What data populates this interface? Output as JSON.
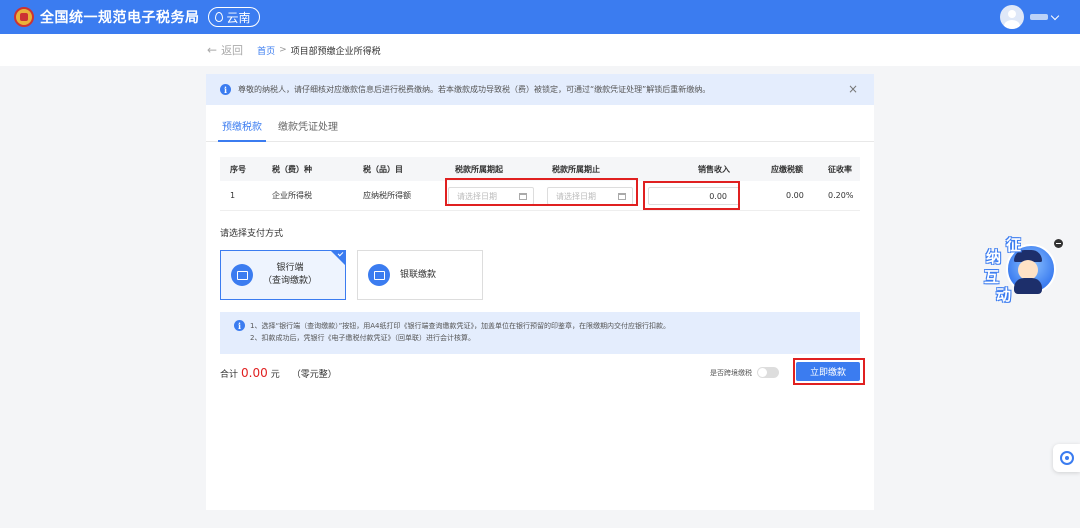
{
  "header": {
    "app_title": "全国统一规范电子税务局",
    "region": "云南",
    "emblem_icon": "tax-emblem-icon",
    "location_icon": "location-pin-icon",
    "avatar_icon": "user-avatar-icon",
    "dropdown_icon": "chevron-down-icon"
  },
  "breadcrumb": {
    "back_label": "返回",
    "home": "首页",
    "separator": ">",
    "current": "项目部预缴企业所得税"
  },
  "notice": {
    "text": "尊敬的纳税人，请仔细核对应缴款信息后进行税费缴纳。若本缴款成功导致税（费）被锁定，可通过“缴款凭证处理”解锁后重新缴纳。",
    "close": "×"
  },
  "tabs": [
    {
      "label": "预缴税款",
      "active": true
    },
    {
      "label": "缴款凭证处理",
      "active": false
    }
  ],
  "table": {
    "headers": [
      "序号",
      "税（费）种",
      "税（品）目",
      "税款所属期起",
      "税款所属期止",
      "销售收入",
      "应缴税额",
      "征收率"
    ],
    "rows": [
      {
        "index": "1",
        "tax_type": "企业所得税",
        "tax_item": "应纳税所得额",
        "period_start_placeholder": "请选择日期",
        "period_end_placeholder": "请选择日期",
        "sales_income": "0.00",
        "tax_due": "0.00",
        "rate": "0.20%"
      }
    ]
  },
  "payment": {
    "label": "请选择支付方式",
    "options": [
      {
        "line1": "银行端",
        "line2": "（查询缴款）",
        "selected": true
      },
      {
        "line1": "银联缴款",
        "line2": "",
        "selected": false
      }
    ]
  },
  "tip": {
    "line1": "1、选择“银行端（查询缴款）”按钮，用A4纸打印《银行端查询缴款凭证》，加盖单位在银行预留的印鉴章，在限缴期内交付应银行扣款。",
    "line2": "2、扣款成功后，凭银行《电子缴税付款凭证》（回单联）进行会计核算。"
  },
  "footer": {
    "total_label": "合计",
    "total_amount": "0.00",
    "total_unit": "元",
    "total_words": "（零元整）",
    "cross_region_label": "是否跨境缴税",
    "pay_button": "立即缴款"
  },
  "mascot": {
    "chars": [
      "征",
      "纳",
      "互",
      "动"
    ]
  },
  "colors": {
    "primary": "#3b7cf0",
    "highlight_box": "#e02020",
    "amount": "#e02020"
  }
}
